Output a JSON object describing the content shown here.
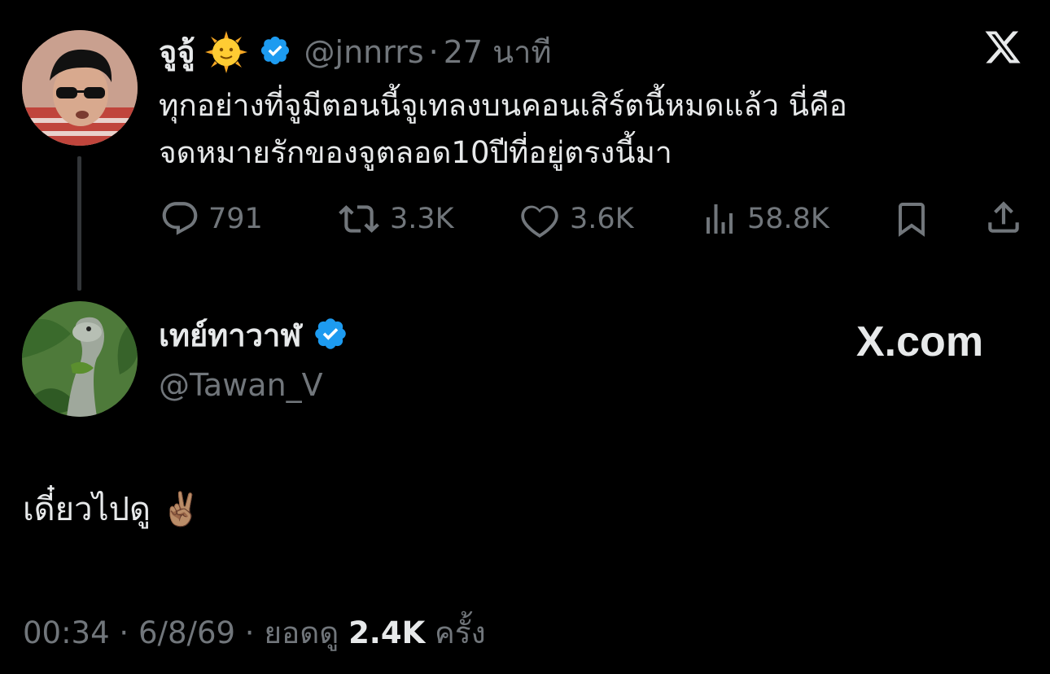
{
  "quoted_tweet": {
    "display_name": "จูจู้",
    "handle": "@jnnrrs",
    "separator": "·",
    "time_ago": "27 นาที",
    "text_line1": "ทุกอย่างที่จูมีตอนนี้จูเทลงบนคอนเสิร์ตนี้หมดแล้ว นี่คือ",
    "text_line2": "จดหมายรักของจูตลอด10ปีที่อยู่ตรงนี้มา",
    "replies": "791",
    "reposts": "3.3K",
    "likes": "3.6K",
    "views": "58.8K"
  },
  "reply_tweet": {
    "display_name": "เทย์ทาวาฬ",
    "handle": "@Tawan_V",
    "text": "เดี๋ยวไปดู ✌🏽",
    "brand_watermark": "X.com"
  },
  "footer": {
    "time": "00:34",
    "sep1": "·",
    "date": "6/8/69",
    "sep2": "·",
    "views_label": "ยอดดู",
    "views_count": "2.4K",
    "views_unit": "ครั้ง"
  },
  "colors": {
    "background": "#000000",
    "primary_text": "#e7e9ea",
    "secondary_text": "#71767b",
    "verified_blue": "#1d9bf0",
    "thread_line": "#333639"
  },
  "icons": [
    "x-logo-icon",
    "verified-badge-icon",
    "sun-emoji-icon",
    "reply-icon",
    "repost-icon",
    "like-icon",
    "views-icon",
    "bookmark-icon",
    "share-icon"
  ]
}
